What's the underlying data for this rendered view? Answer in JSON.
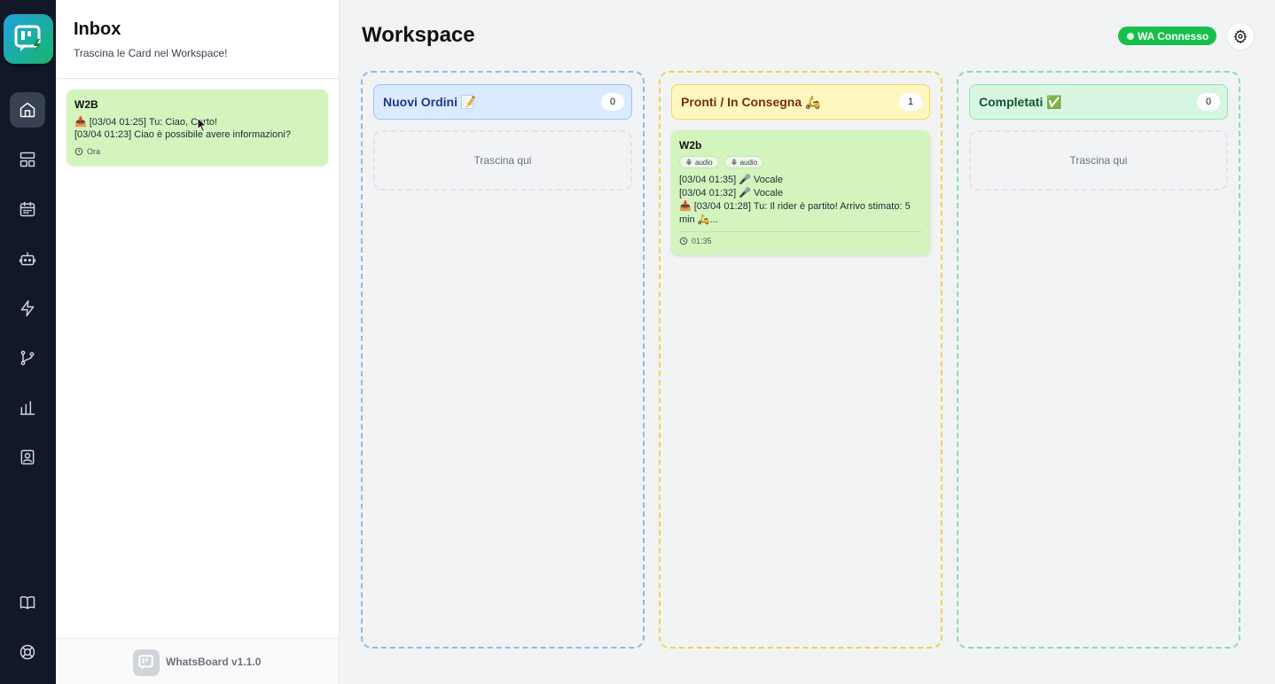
{
  "sidebar": {
    "items": [
      {
        "name": "home-icon",
        "active": true
      },
      {
        "name": "layout-icon"
      },
      {
        "name": "calendar-icon"
      },
      {
        "name": "bot-icon"
      },
      {
        "name": "lightning-icon"
      },
      {
        "name": "git-branch-icon"
      },
      {
        "name": "bar-chart-icon"
      },
      {
        "name": "contacts-icon"
      }
    ],
    "bottom": [
      {
        "name": "book-icon"
      },
      {
        "name": "help-icon"
      }
    ]
  },
  "inbox": {
    "title": "Inbox",
    "subtitle": "Trascina le Card nel Workspace!",
    "cards": [
      {
        "title": "W2B",
        "line1": "📥 [03/04 01:25] Tu: Ciao, Certo!",
        "line2": "[03/04 01:23] Ciao è possibile avere informazioni?",
        "time": "Ora"
      }
    ],
    "footer": "WhatsBoard v1.1.0"
  },
  "workspace": {
    "title": "Workspace",
    "status_badge": "WA Connesso",
    "columns": [
      {
        "title": "Nuovi Ordini 📝",
        "count": "0",
        "drop_text": "Trascina qui"
      },
      {
        "title": "Pronti / In Consegna 🛵",
        "count": "1"
      },
      {
        "title": "Completati ✅",
        "count": "0",
        "drop_text": "Trascina qui"
      }
    ],
    "card": {
      "title": "W2b",
      "chips": [
        "audio",
        "audio"
      ],
      "line1": "[03/04 01:35] 🎤 Vocale",
      "line2": "[03/04 01:32] 🎤 Vocale",
      "line3": "📥 [03/04 01:28] Tu: Il rider è partito! Arrivo stimato: 5 min 🛵...",
      "time": "01:35"
    }
  },
  "colors": {
    "rail": "#111827",
    "accent_green": "#16c04a",
    "card_green": "#d3f5bd"
  }
}
